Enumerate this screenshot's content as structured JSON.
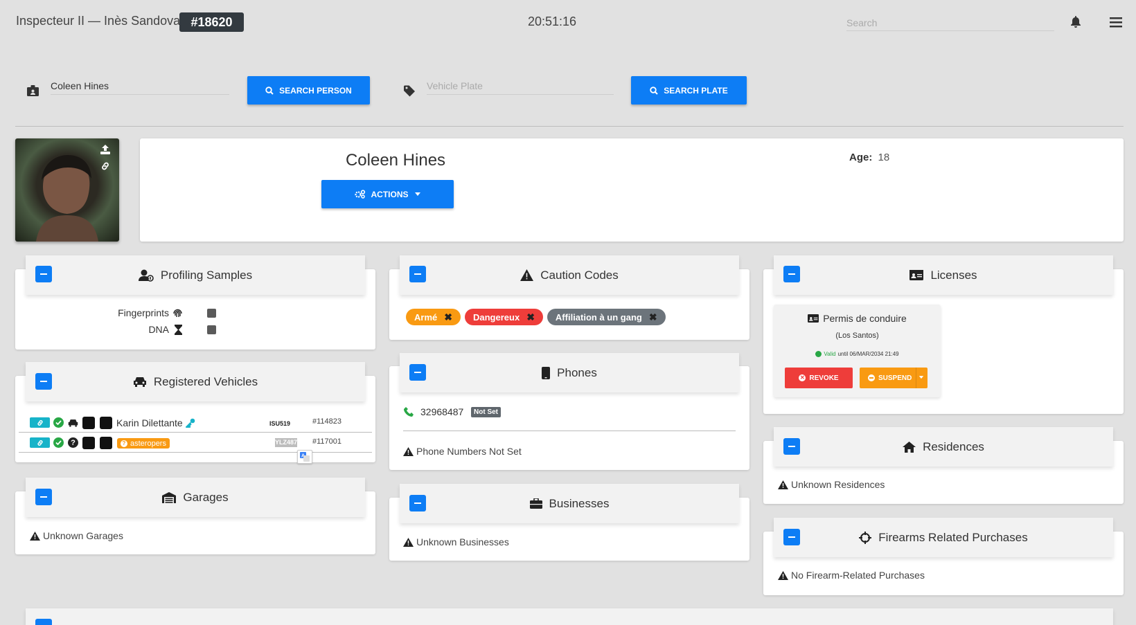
{
  "header": {
    "title": "Inspecteur II — Inès Sandoval",
    "badge": "#18620",
    "clock": "20:51:16",
    "search_placeholder": "Search"
  },
  "search": {
    "person_value": "Coleen Hines",
    "person_button": "SEARCH PERSON",
    "plate_placeholder": "Vehicle Plate",
    "plate_button": "SEARCH PLATE"
  },
  "profile": {
    "name": "Coleen Hines",
    "actions_label": "ACTIONS",
    "age_label": "Age:",
    "age_value": "18"
  },
  "profiling": {
    "title": "Profiling Samples",
    "rows": [
      {
        "label": "Fingerprints"
      },
      {
        "label": "DNA"
      }
    ]
  },
  "vehicles": {
    "title": "Registered Vehicles",
    "rows": [
      {
        "owner": "Karin Dilettante",
        "plate": "ISU519",
        "id": "#114823"
      },
      {
        "badge": "asteropers",
        "plate": "YLZ487",
        "id": "#117001"
      }
    ]
  },
  "garages": {
    "title": "Garages",
    "empty": "Unknown Garages"
  },
  "caution": {
    "title": "Caution Codes",
    "tags": [
      {
        "label": "Armé",
        "color": "#f99a12"
      },
      {
        "label": "Dangereux",
        "color": "#ee3d3a"
      },
      {
        "label": "Affiliation à un gang",
        "color": "#6c747b"
      }
    ]
  },
  "phones": {
    "title": "Phones",
    "number": "32968487",
    "number_badge": "Not Set",
    "notice": "Phone Numbers Not Set"
  },
  "businesses": {
    "title": "Businesses",
    "empty": "Unknown Businesses"
  },
  "licenses": {
    "title": "Licenses",
    "item_title": "Permis de conduire",
    "item_region": "(Los Santos)",
    "valid_label": "Valid",
    "valid_until": "until 06/MAR/2034 21:49",
    "revoke": "REVOKE",
    "suspend": "SUSPEND"
  },
  "residences": {
    "title": "Residences",
    "empty": "Unknown Residences"
  },
  "firearms": {
    "title": "Firearms Related Purchases",
    "empty": "No Firearm-Related Purchases"
  },
  "colors": {
    "primary": "#0d7df5",
    "danger": "#ee3d3a",
    "warning": "#f99a12",
    "dark": "#333a40",
    "teal": "#17b3c9",
    "success": "#28a745"
  }
}
